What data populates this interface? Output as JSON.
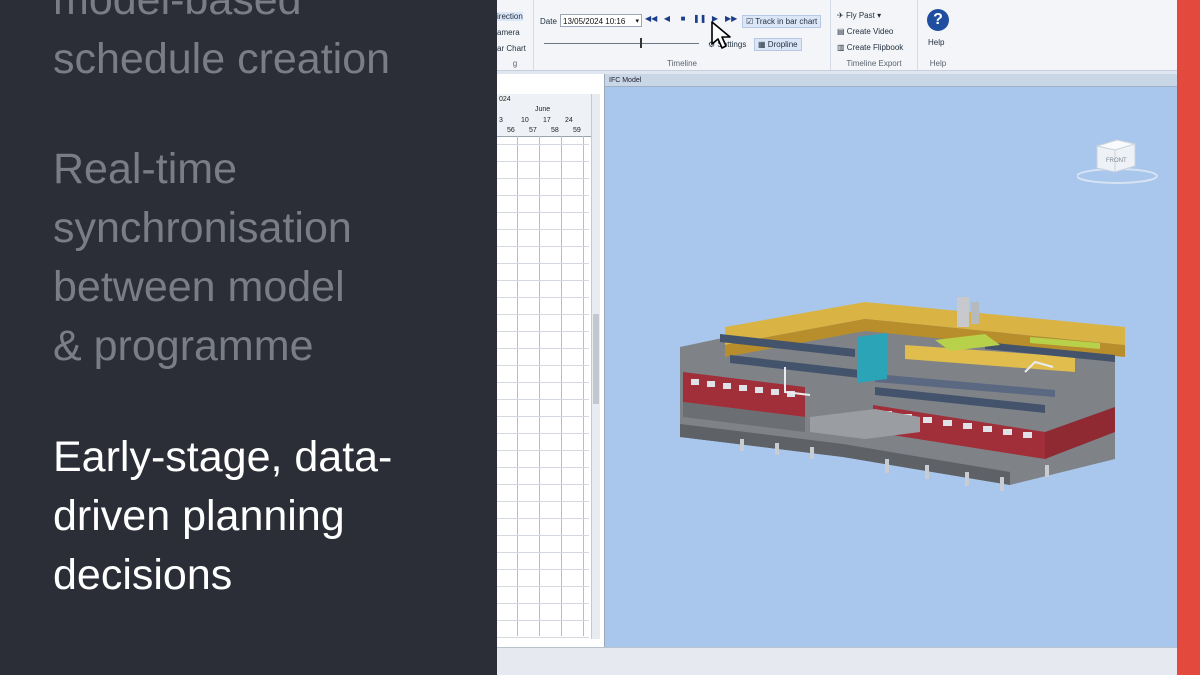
{
  "slide": {
    "bullets": [
      {
        "text": "model-based\nschedule creation",
        "active": false
      },
      {
        "text": "Real-time\nsynchronisation\nbetween model\n& programme",
        "active": false
      },
      {
        "text": "Early-stage, data-\ndriven planning\ndecisions",
        "active": true
      }
    ]
  },
  "app": {
    "ribbon": {
      "left_items": [
        "irection",
        "amera",
        "ar Chart"
      ],
      "left_group_label": "g",
      "date_label": "Date",
      "date_value": "13/05/2024 10:16",
      "track_label": "Track in bar chart",
      "settings_label": "Settings",
      "dropline_label": "Dropline",
      "timeline_label": "Timeline",
      "export_items": [
        "Fly Past",
        "Create Video",
        "Create Flipbook"
      ],
      "export_label": "Timeline Export",
      "help_label": "Help",
      "help_group_label": "Help"
    },
    "gantt": {
      "year": "024",
      "month": "June",
      "dates": [
        "3",
        "10",
        "17",
        "24"
      ],
      "weeks": [
        "56",
        "57",
        "58",
        "59"
      ]
    },
    "viewport": {
      "title": "IFC Model",
      "cube_label": "FRONT"
    }
  },
  "colors": {
    "slide_bg": "#2b2e37",
    "muted_text": "#7a7d86",
    "active_text": "#ffffff",
    "viewport_bg": "#a9c7ec",
    "accent_red": "#e34a3d"
  }
}
